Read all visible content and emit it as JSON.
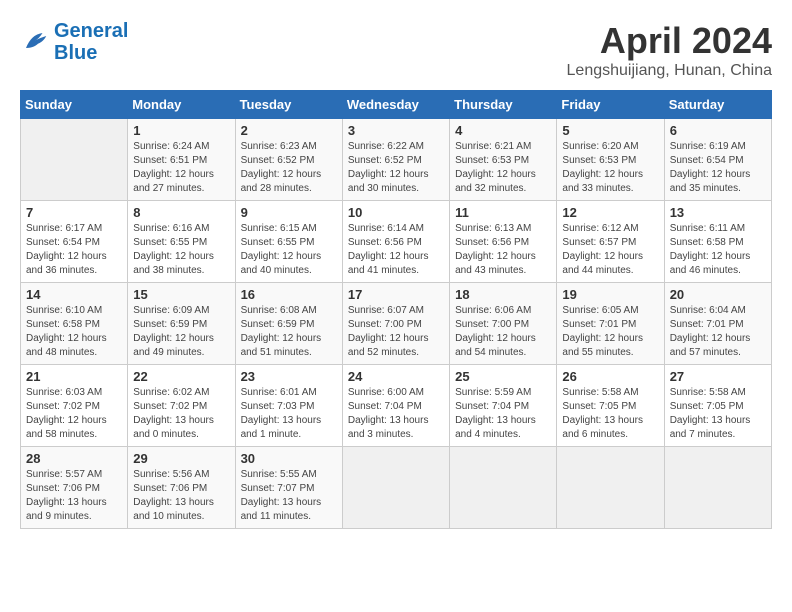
{
  "logo": {
    "line1": "General",
    "line2": "Blue"
  },
  "title": "April 2024",
  "subtitle": "Lengshuijiang, Hunan, China",
  "days_of_week": [
    "Sunday",
    "Monday",
    "Tuesday",
    "Wednesday",
    "Thursday",
    "Friday",
    "Saturday"
  ],
  "weeks": [
    [
      {
        "day": "",
        "info": ""
      },
      {
        "day": "1",
        "info": "Sunrise: 6:24 AM\nSunset: 6:51 PM\nDaylight: 12 hours\nand 27 minutes."
      },
      {
        "day": "2",
        "info": "Sunrise: 6:23 AM\nSunset: 6:52 PM\nDaylight: 12 hours\nand 28 minutes."
      },
      {
        "day": "3",
        "info": "Sunrise: 6:22 AM\nSunset: 6:52 PM\nDaylight: 12 hours\nand 30 minutes."
      },
      {
        "day": "4",
        "info": "Sunrise: 6:21 AM\nSunset: 6:53 PM\nDaylight: 12 hours\nand 32 minutes."
      },
      {
        "day": "5",
        "info": "Sunrise: 6:20 AM\nSunset: 6:53 PM\nDaylight: 12 hours\nand 33 minutes."
      },
      {
        "day": "6",
        "info": "Sunrise: 6:19 AM\nSunset: 6:54 PM\nDaylight: 12 hours\nand 35 minutes."
      }
    ],
    [
      {
        "day": "7",
        "info": "Sunrise: 6:17 AM\nSunset: 6:54 PM\nDaylight: 12 hours\nand 36 minutes."
      },
      {
        "day": "8",
        "info": "Sunrise: 6:16 AM\nSunset: 6:55 PM\nDaylight: 12 hours\nand 38 minutes."
      },
      {
        "day": "9",
        "info": "Sunrise: 6:15 AM\nSunset: 6:55 PM\nDaylight: 12 hours\nand 40 minutes."
      },
      {
        "day": "10",
        "info": "Sunrise: 6:14 AM\nSunset: 6:56 PM\nDaylight: 12 hours\nand 41 minutes."
      },
      {
        "day": "11",
        "info": "Sunrise: 6:13 AM\nSunset: 6:56 PM\nDaylight: 12 hours\nand 43 minutes."
      },
      {
        "day": "12",
        "info": "Sunrise: 6:12 AM\nSunset: 6:57 PM\nDaylight: 12 hours\nand 44 minutes."
      },
      {
        "day": "13",
        "info": "Sunrise: 6:11 AM\nSunset: 6:58 PM\nDaylight: 12 hours\nand 46 minutes."
      }
    ],
    [
      {
        "day": "14",
        "info": "Sunrise: 6:10 AM\nSunset: 6:58 PM\nDaylight: 12 hours\nand 48 minutes."
      },
      {
        "day": "15",
        "info": "Sunrise: 6:09 AM\nSunset: 6:59 PM\nDaylight: 12 hours\nand 49 minutes."
      },
      {
        "day": "16",
        "info": "Sunrise: 6:08 AM\nSunset: 6:59 PM\nDaylight: 12 hours\nand 51 minutes."
      },
      {
        "day": "17",
        "info": "Sunrise: 6:07 AM\nSunset: 7:00 PM\nDaylight: 12 hours\nand 52 minutes."
      },
      {
        "day": "18",
        "info": "Sunrise: 6:06 AM\nSunset: 7:00 PM\nDaylight: 12 hours\nand 54 minutes."
      },
      {
        "day": "19",
        "info": "Sunrise: 6:05 AM\nSunset: 7:01 PM\nDaylight: 12 hours\nand 55 minutes."
      },
      {
        "day": "20",
        "info": "Sunrise: 6:04 AM\nSunset: 7:01 PM\nDaylight: 12 hours\nand 57 minutes."
      }
    ],
    [
      {
        "day": "21",
        "info": "Sunrise: 6:03 AM\nSunset: 7:02 PM\nDaylight: 12 hours\nand 58 minutes."
      },
      {
        "day": "22",
        "info": "Sunrise: 6:02 AM\nSunset: 7:02 PM\nDaylight: 13 hours\nand 0 minutes."
      },
      {
        "day": "23",
        "info": "Sunrise: 6:01 AM\nSunset: 7:03 PM\nDaylight: 13 hours\nand 1 minute."
      },
      {
        "day": "24",
        "info": "Sunrise: 6:00 AM\nSunset: 7:04 PM\nDaylight: 13 hours\nand 3 minutes."
      },
      {
        "day": "25",
        "info": "Sunrise: 5:59 AM\nSunset: 7:04 PM\nDaylight: 13 hours\nand 4 minutes."
      },
      {
        "day": "26",
        "info": "Sunrise: 5:58 AM\nSunset: 7:05 PM\nDaylight: 13 hours\nand 6 minutes."
      },
      {
        "day": "27",
        "info": "Sunrise: 5:58 AM\nSunset: 7:05 PM\nDaylight: 13 hours\nand 7 minutes."
      }
    ],
    [
      {
        "day": "28",
        "info": "Sunrise: 5:57 AM\nSunset: 7:06 PM\nDaylight: 13 hours\nand 9 minutes."
      },
      {
        "day": "29",
        "info": "Sunrise: 5:56 AM\nSunset: 7:06 PM\nDaylight: 13 hours\nand 10 minutes."
      },
      {
        "day": "30",
        "info": "Sunrise: 5:55 AM\nSunset: 7:07 PM\nDaylight: 13 hours\nand 11 minutes."
      },
      {
        "day": "",
        "info": ""
      },
      {
        "day": "",
        "info": ""
      },
      {
        "day": "",
        "info": ""
      },
      {
        "day": "",
        "info": ""
      }
    ]
  ]
}
